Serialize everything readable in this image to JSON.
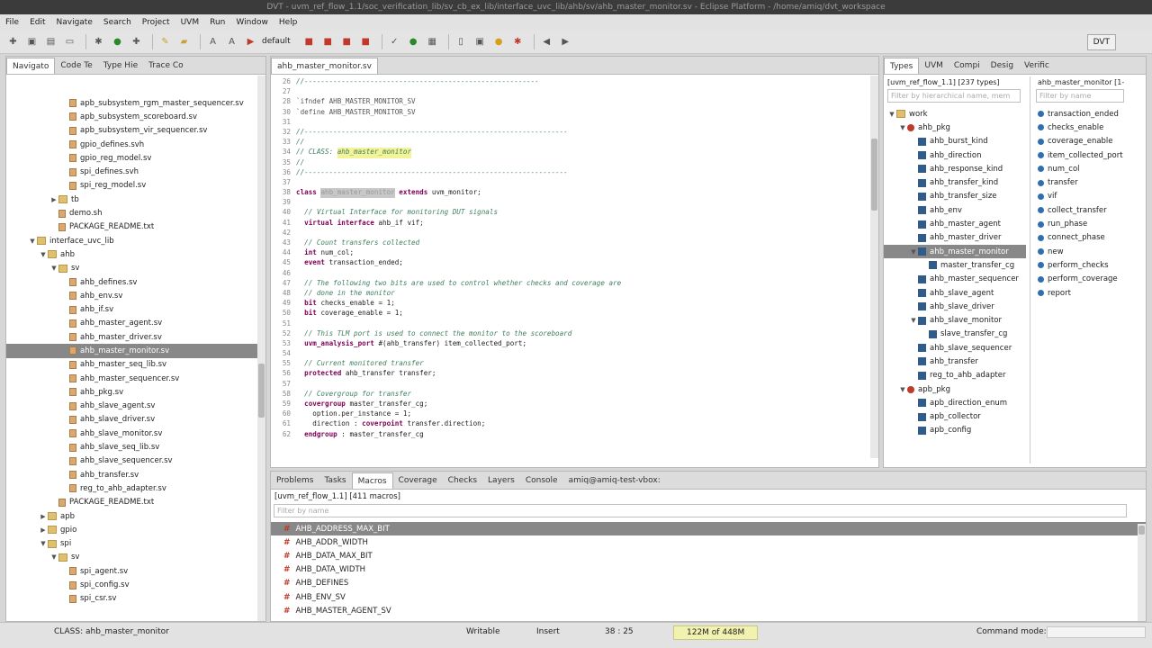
{
  "window": {
    "title": "DVT - uvm_ref_flow_1.1/soc_verification_lib/sv_cb_ex_lib/interface_uvc_lib/ahb/sv/ahb_master_monitor.sv - Eclipse Platform - /home/amiq/dvt_workspace"
  },
  "menu": [
    "File",
    "Edit",
    "Navigate",
    "Search",
    "Project",
    "UVM",
    "Run",
    "Window",
    "Help"
  ],
  "toolbar": {
    "build_config": "default",
    "perspective": "DVT"
  },
  "left_panel": {
    "tabs": [
      "Navigato",
      "Code Te",
      "Type Hie",
      "Trace Co"
    ],
    "items": [
      {
        "label": "apb_subsystem_rgm_master_sequencer.sv",
        "depth": 4,
        "kind": "file"
      },
      {
        "label": "apb_subsystem_scoreboard.sv",
        "depth": 4,
        "kind": "file"
      },
      {
        "label": "apb_subsystem_vir_sequencer.sv",
        "depth": 4,
        "kind": "file"
      },
      {
        "label": "gpio_defines.svh",
        "depth": 4,
        "kind": "file"
      },
      {
        "label": "gpio_reg_model.sv",
        "depth": 4,
        "kind": "file"
      },
      {
        "label": "spi_defines.svh",
        "depth": 4,
        "kind": "file"
      },
      {
        "label": "spi_reg_model.sv",
        "depth": 4,
        "kind": "file"
      },
      {
        "label": "tb",
        "depth": 3,
        "kind": "folder",
        "arrow": "▶"
      },
      {
        "label": "demo.sh",
        "depth": 3,
        "kind": "file"
      },
      {
        "label": "PACKAGE_README.txt",
        "depth": 3,
        "kind": "file"
      },
      {
        "label": "interface_uvc_lib",
        "depth": 1,
        "kind": "folder",
        "arrow": "▼"
      },
      {
        "label": "ahb",
        "depth": 2,
        "kind": "folder",
        "arrow": "▼"
      },
      {
        "label": "sv",
        "depth": 3,
        "kind": "folder",
        "arrow": "▼"
      },
      {
        "label": "ahb_defines.sv",
        "depth": 4,
        "kind": "file"
      },
      {
        "label": "ahb_env.sv",
        "depth": 4,
        "kind": "file"
      },
      {
        "label": "ahb_if.sv",
        "depth": 4,
        "kind": "file"
      },
      {
        "label": "ahb_master_agent.sv",
        "depth": 4,
        "kind": "file"
      },
      {
        "label": "ahb_master_driver.sv",
        "depth": 4,
        "kind": "file"
      },
      {
        "label": "ahb_master_monitor.sv",
        "depth": 4,
        "kind": "file",
        "selected": true
      },
      {
        "label": "ahb_master_seq_lib.sv",
        "depth": 4,
        "kind": "file"
      },
      {
        "label": "ahb_master_sequencer.sv",
        "depth": 4,
        "kind": "file"
      },
      {
        "label": "ahb_pkg.sv",
        "depth": 4,
        "kind": "file"
      },
      {
        "label": "ahb_slave_agent.sv",
        "depth": 4,
        "kind": "file"
      },
      {
        "label": "ahb_slave_driver.sv",
        "depth": 4,
        "kind": "file"
      },
      {
        "label": "ahb_slave_monitor.sv",
        "depth": 4,
        "kind": "file"
      },
      {
        "label": "ahb_slave_seq_lib.sv",
        "depth": 4,
        "kind": "file"
      },
      {
        "label": "ahb_slave_sequencer.sv",
        "depth": 4,
        "kind": "file"
      },
      {
        "label": "ahb_transfer.sv",
        "depth": 4,
        "kind": "file"
      },
      {
        "label": "reg_to_ahb_adapter.sv",
        "depth": 4,
        "kind": "file"
      },
      {
        "label": "PACKAGE_README.txt",
        "depth": 3,
        "kind": "file"
      },
      {
        "label": "apb",
        "depth": 2,
        "kind": "folder",
        "arrow": "▶"
      },
      {
        "label": "gpio",
        "depth": 2,
        "kind": "folder",
        "arrow": "▶"
      },
      {
        "label": "spi",
        "depth": 2,
        "kind": "folder",
        "arrow": "▼"
      },
      {
        "label": "sv",
        "depth": 3,
        "kind": "folder",
        "arrow": "▼"
      },
      {
        "label": "spi_agent.sv",
        "depth": 4,
        "kind": "file"
      },
      {
        "label": "spi_config.sv",
        "depth": 4,
        "kind": "file"
      },
      {
        "label": "spi_csr.sv",
        "depth": 4,
        "kind": "file"
      }
    ]
  },
  "editor": {
    "tab": "ahb_master_monitor.sv",
    "lines": [
      {
        "n": "26",
        "parts": [
          {
            "t": "//---------------------------------------------------------",
            "c": "cm"
          }
        ]
      },
      {
        "n": "27",
        "parts": []
      },
      {
        "n": "28",
        "parts": [
          {
            "t": "`ifndef AHB_MASTER_MONITOR_SV",
            "c": "dir"
          }
        ]
      },
      {
        "n": "30",
        "parts": [
          {
            "t": "`define AHB_MASTER_MONITOR_SV",
            "c": "dir"
          }
        ]
      },
      {
        "n": "31",
        "parts": []
      },
      {
        "n": "32",
        "parts": [
          {
            "t": "//----------------------------------------------------------------",
            "c": "cm"
          }
        ]
      },
      {
        "n": "33",
        "parts": [
          {
            "t": "//",
            "c": "cm"
          }
        ]
      },
      {
        "n": "34",
        "parts": [
          {
            "t": "// CLASS: ",
            "c": "cm"
          },
          {
            "t": "ahb_master_monitor",
            "c": "cm hl"
          }
        ]
      },
      {
        "n": "35",
        "parts": [
          {
            "t": "//",
            "c": "cm"
          }
        ]
      },
      {
        "n": "36",
        "parts": [
          {
            "t": "//----------------------------------------------------------------",
            "c": "cm"
          }
        ]
      },
      {
        "n": "37",
        "parts": []
      },
      {
        "n": "38",
        "parts": [
          {
            "t": "class ",
            "c": "kw"
          },
          {
            "t": "ahb_master_monitor",
            "c": "hl2"
          },
          {
            "t": " extends ",
            "c": "kw"
          },
          {
            "t": "uvm_monitor;",
            "c": ""
          }
        ]
      },
      {
        "n": "39",
        "parts": []
      },
      {
        "n": "40",
        "parts": [
          {
            "t": "  // Virtual Interface for monitoring DUT signals",
            "c": "cm"
          }
        ]
      },
      {
        "n": "41",
        "parts": [
          {
            "t": "  virtual interface ",
            "c": "kw"
          },
          {
            "t": "ahb_if vif;",
            "c": ""
          }
        ]
      },
      {
        "n": "42",
        "parts": []
      },
      {
        "n": "43",
        "parts": [
          {
            "t": "  // Count transfers collected",
            "c": "cm"
          }
        ]
      },
      {
        "n": "44",
        "parts": [
          {
            "t": "  int ",
            "c": "kw"
          },
          {
            "t": "num_col;",
            "c": ""
          }
        ]
      },
      {
        "n": "45",
        "parts": [
          {
            "t": "  event ",
            "c": "kw"
          },
          {
            "t": "transaction_ended;",
            "c": ""
          }
        ]
      },
      {
        "n": "46",
        "parts": []
      },
      {
        "n": "47",
        "parts": [
          {
            "t": "  // The following two bits are used to control whether checks and coverage are",
            "c": "cm"
          }
        ]
      },
      {
        "n": "48",
        "parts": [
          {
            "t": "  // done in the monitor",
            "c": "cm"
          }
        ]
      },
      {
        "n": "49",
        "parts": [
          {
            "t": "  bit ",
            "c": "kw"
          },
          {
            "t": "checks_enable = 1;",
            "c": ""
          }
        ]
      },
      {
        "n": "50",
        "parts": [
          {
            "t": "  bit ",
            "c": "kw"
          },
          {
            "t": "coverage_enable = 1;",
            "c": ""
          }
        ]
      },
      {
        "n": "51",
        "parts": []
      },
      {
        "n": "52",
        "parts": [
          {
            "t": "  // This TLM port is used to connect the monitor to the scoreboard",
            "c": "cm"
          }
        ]
      },
      {
        "n": "53",
        "parts": [
          {
            "t": "  uvm_analysis_port ",
            "c": "kw"
          },
          {
            "t": "#(ahb_transfer) item_collected_port;",
            "c": ""
          }
        ]
      },
      {
        "n": "54",
        "parts": []
      },
      {
        "n": "55",
        "parts": [
          {
            "t": "  // Current monitored transfer",
            "c": "cm"
          }
        ]
      },
      {
        "n": "56",
        "parts": [
          {
            "t": "  protected ",
            "c": "kw"
          },
          {
            "t": "ahb_transfer transfer;",
            "c": ""
          }
        ]
      },
      {
        "n": "57",
        "parts": []
      },
      {
        "n": "58",
        "parts": [
          {
            "t": "  // Covergroup for transfer",
            "c": "cm"
          }
        ]
      },
      {
        "n": "59",
        "parts": [
          {
            "t": "  covergroup ",
            "c": "kw"
          },
          {
            "t": "master_transfer_cg;",
            "c": ""
          }
        ]
      },
      {
        "n": "60",
        "parts": [
          {
            "t": "    option.per_instance = 1;",
            "c": ""
          }
        ]
      },
      {
        "n": "61",
        "parts": [
          {
            "t": "    direction : ",
            "c": ""
          },
          {
            "t": "coverpoint ",
            "c": "kw"
          },
          {
            "t": "transfer.direction;",
            "c": ""
          }
        ]
      },
      {
        "n": "62",
        "parts": [
          {
            "t": "  endgroup ",
            "c": "kw"
          },
          {
            "t": ": master_transfer_cg",
            "c": ""
          }
        ]
      }
    ]
  },
  "right_panel": {
    "tabs": [
      "Types",
      "UVM",
      "Compi",
      "Desig",
      "Verific"
    ],
    "types_header": "[uvm_ref_flow_1.1] [237 types]",
    "types_filter": "Filter by hierarchical name, mem",
    "members_header": "ahb_master_monitor [1-",
    "members_filter": "Filter by name",
    "types": [
      {
        "label": "work",
        "depth": 0,
        "kind": "folder",
        "arrow": "▼"
      },
      {
        "label": "ahb_pkg",
        "depth": 1,
        "kind": "pkg",
        "arrow": "▼"
      },
      {
        "label": "ahb_burst_kind",
        "depth": 2,
        "kind": "cls"
      },
      {
        "label": "ahb_direction",
        "depth": 2,
        "kind": "cls"
      },
      {
        "label": "ahb_response_kind",
        "depth": 2,
        "kind": "cls"
      },
      {
        "label": "ahb_transfer_kind",
        "depth": 2,
        "kind": "cls"
      },
      {
        "label": "ahb_transfer_size",
        "depth": 2,
        "kind": "cls"
      },
      {
        "label": "ahb_env",
        "depth": 2,
        "kind": "cls"
      },
      {
        "label": "ahb_master_agent",
        "depth": 2,
        "kind": "cls"
      },
      {
        "label": "ahb_master_driver",
        "depth": 2,
        "kind": "cls"
      },
      {
        "label": "ahb_master_monitor",
        "depth": 2,
        "kind": "cls",
        "arrow": "▼",
        "selected": true
      },
      {
        "label": "master_transfer_cg",
        "depth": 3,
        "kind": "cls"
      },
      {
        "label": "ahb_master_sequencer",
        "depth": 2,
        "kind": "cls"
      },
      {
        "label": "ahb_slave_agent",
        "depth": 2,
        "kind": "cls"
      },
      {
        "label": "ahb_slave_driver",
        "depth": 2,
        "kind": "cls"
      },
      {
        "label": "ahb_slave_monitor",
        "depth": 2,
        "kind": "cls",
        "arrow": "▼"
      },
      {
        "label": "slave_transfer_cg",
        "depth": 3,
        "kind": "cls"
      },
      {
        "label": "ahb_slave_sequencer",
        "depth": 2,
        "kind": "cls"
      },
      {
        "label": "ahb_transfer",
        "depth": 2,
        "kind": "cls"
      },
      {
        "label": "reg_to_ahb_adapter",
        "depth": 2,
        "kind": "cls"
      },
      {
        "label": "apb_pkg",
        "depth": 1,
        "kind": "pkg",
        "arrow": "▼"
      },
      {
        "label": "apb_direction_enum",
        "depth": 2,
        "kind": "cls"
      },
      {
        "label": "apb_collector",
        "depth": 2,
        "kind": "cls"
      },
      {
        "label": "apb_config",
        "depth": 2,
        "kind": "cls"
      }
    ],
    "members": [
      "transaction_ended",
      "checks_enable",
      "coverage_enable",
      "item_collected_port",
      "num_col",
      "transfer",
      "vif",
      "collect_transfer",
      "run_phase",
      "connect_phase",
      "new",
      "perform_checks",
      "perform_coverage",
      "report"
    ]
  },
  "bottom_panel": {
    "tabs": [
      "Problems",
      "Tasks",
      "Macros",
      "Coverage",
      "Checks",
      "Layers",
      "Console",
      "amiq@amiq-test-vbox:"
    ],
    "header": "[uvm_ref_flow_1.1] [411 macros]",
    "filter": "Filter by name",
    "macros": [
      "AHB_ADDRESS_MAX_BIT",
      "AHB_ADDR_WIDTH",
      "AHB_DATA_MAX_BIT",
      "AHB_DATA_WIDTH",
      "AHB_DEFINES",
      "AHB_ENV_SV",
      "AHB_MASTER_AGENT_SV"
    ]
  },
  "status": {
    "element": "CLASS: ahb_master_monitor",
    "writable": "Writable",
    "insert": "Insert",
    "position": "38 : 25",
    "memory": "122M of 448M",
    "command": "Command mode:"
  }
}
